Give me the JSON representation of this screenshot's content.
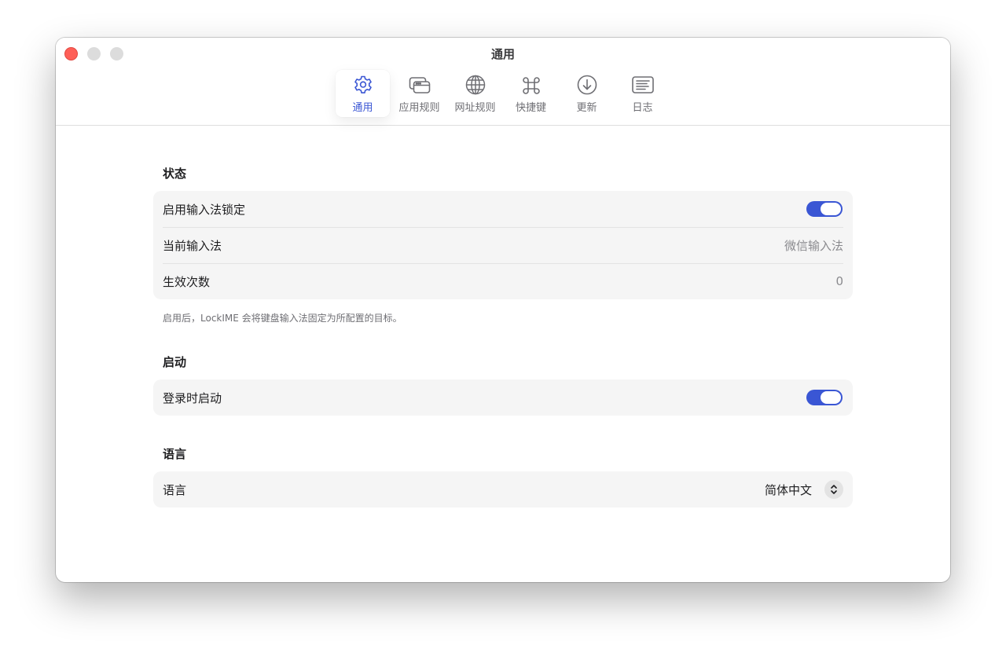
{
  "window": {
    "title": "通用"
  },
  "toolbar": {
    "tabs": [
      {
        "label": "通用",
        "icon": "gear-icon",
        "active": true
      },
      {
        "label": "应用规则",
        "icon": "app-windows-icon",
        "active": false
      },
      {
        "label": "网址规则",
        "icon": "globe-icon",
        "active": false
      },
      {
        "label": "快捷键",
        "icon": "command-icon",
        "active": false
      },
      {
        "label": "更新",
        "icon": "download-circle-icon",
        "active": false
      },
      {
        "label": "日志",
        "icon": "log-list-icon",
        "active": false
      }
    ]
  },
  "status": {
    "title": "状态",
    "enable_lock_label": "启用输入法锁定",
    "enable_lock_on": true,
    "current_ime_label": "当前输入法",
    "current_ime_value": "微信输入法",
    "count_label": "生效次数",
    "count_value": "0",
    "caption": "启用后，LockIME 会将键盘输入法固定为所配置的目标。"
  },
  "startup": {
    "title": "启动",
    "launch_at_login_label": "登录时启动",
    "launch_at_login_on": true
  },
  "language": {
    "title": "语言",
    "label": "语言",
    "selected": "简体中文"
  },
  "colors": {
    "accent": "#3a56d4",
    "close": "#fe5f57",
    "group_bg": "#f5f5f5"
  }
}
